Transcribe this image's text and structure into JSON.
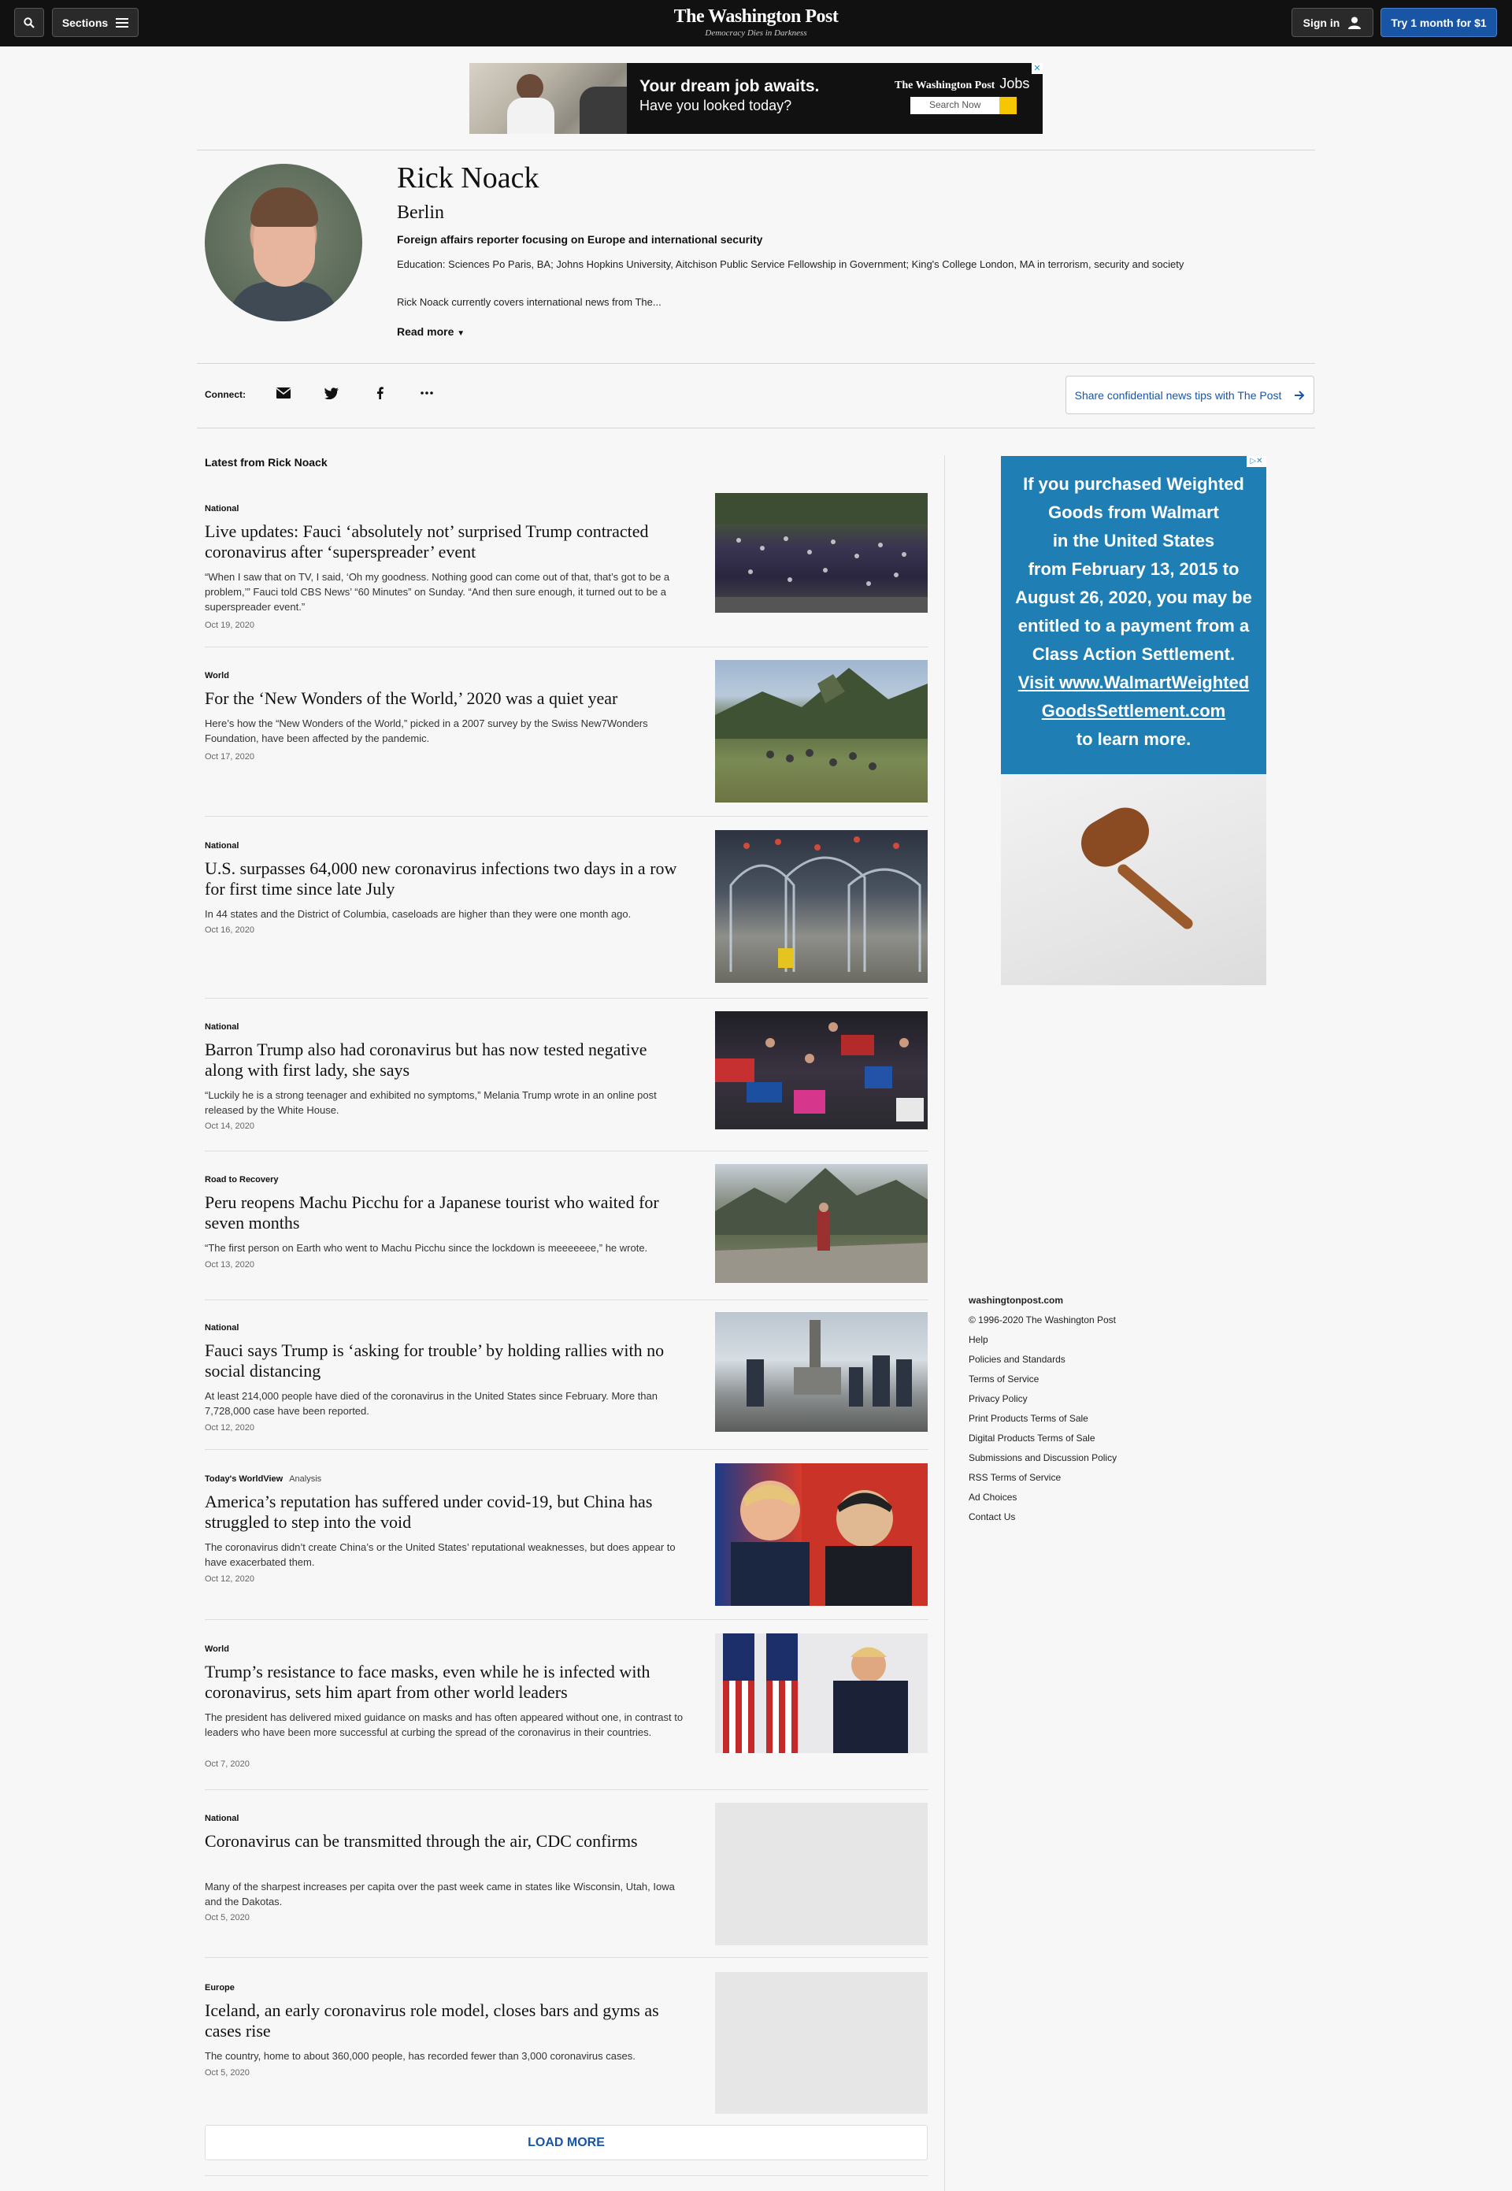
{
  "nav": {
    "sections_label": "Sections",
    "brand": "The Washington Post",
    "tagline": "Democracy Dies in Darkness",
    "signin_label": "Sign in",
    "subscribe_label": "Try 1 month for $1"
  },
  "top_ad": {
    "headline": "Your dream job awaits.",
    "subline": "Have you looked today?",
    "brand": "The Washington Post",
    "brand_suffix": "Jobs",
    "search_label": "Search Now"
  },
  "profile": {
    "name": "Rick Noack",
    "location": "Berlin",
    "title": "Foreign affairs reporter focusing on Europe and international security",
    "education": "Education: Sciences Po Paris, BA; Johns Hopkins University, Aitchison Public Service Fellowship in Government; King's College London, MA in terrorism, security and society",
    "bio": "Rick Noack currently covers international news from The...",
    "read_more": "Read more"
  },
  "connect": {
    "label": "Connect:",
    "icons": [
      "email-icon",
      "twitter-icon",
      "facebook-icon",
      "more-icon"
    ],
    "tips_label": "Share confidential news tips with The Post"
  },
  "latest_title": "Latest from Rick Noack",
  "articles": [
    {
      "kicker": "National",
      "headline": "Live updates: Fauci ‘absolutely not’ surprised Trump contracted coronavirus after ‘superspreader’ event",
      "blurb": "“When I saw that on TV, I said, ‘Oh my goodness. Nothing good can come out of that, that’s got to be a problem,’” Fauci told CBS News’ “60 Minutes” on Sunday. “And then sure enough, it turned out to be a superspreader event.”",
      "date": "Oct 19, 2020"
    },
    {
      "kicker": "World",
      "headline": "For the ‘New Wonders of the World,’ 2020 was a quiet year",
      "blurb": "Here’s how the “New Wonders of the World,” picked in a 2007 survey by the Swiss New7Wonders Foundation, have been affected by the pandemic.",
      "date": "Oct 17, 2020"
    },
    {
      "kicker": "National",
      "headline": "U.S. surpasses 64,000 new coronavirus infections two days in a row for first time since late July",
      "blurb": "In 44 states and the District of Columbia, caseloads are higher than they were one month ago.",
      "date": "Oct 16, 2020"
    },
    {
      "kicker": "National",
      "headline": "Barron Trump also had coronavirus but has now tested negative along with first lady, she says",
      "blurb": "“Luckily he is a strong teenager and exhibited no symptoms,” Melania Trump wrote in an online post released by the White House.",
      "date": "Oct 14, 2020"
    },
    {
      "kicker": "Road to Recovery",
      "headline": "Peru reopens Machu Picchu for a Japanese tourist who waited for seven months",
      "blurb": "“The first person on Earth who went to Machu Picchu since the lockdown is meeeeeee,” he wrote.",
      "date": "Oct 13, 2020"
    },
    {
      "kicker": "National",
      "headline": "Fauci says Trump is ‘asking for trouble’ by holding rallies with no social distancing",
      "blurb": "At least 214,000 people have died of the coronavirus in the United States since February. More than 7,728,000 case have been reported.",
      "date": "Oct 12, 2020"
    },
    {
      "kicker": "Today's WorldView",
      "kicker_extra": "Analysis",
      "headline": "America’s reputation has suffered under covid-19, but China has struggled to step into the void",
      "blurb": "The coronavirus didn’t create China’s or the United States’ reputational weaknesses, but does appear to have exacerbated them.",
      "date": "Oct 12, 2020"
    },
    {
      "kicker": "World",
      "headline": "Trump’s resistance to face masks, even while he is infected with coronavirus, sets him apart from other world leaders",
      "blurb": "The president has delivered mixed guidance on masks and has often appeared without one, in contrast to leaders who have been more successful at curbing the spread of the coronavirus in their countries.",
      "date": "Oct 7, 2020"
    },
    {
      "kicker": "National",
      "headline": "Coronavirus can be transmitted through the air, CDC confirms",
      "blurb": "Many of the sharpest increases per capita over the past week came in states like Wisconsin, Utah, Iowa and the Dakotas.",
      "date": "Oct 5, 2020"
    },
    {
      "kicker": "Europe",
      "headline": "Iceland, an early coronavirus role model, closes bars and gyms as cases rise",
      "blurb": "The country, home to about 360,000 people, has recorded fewer than 3,000 coronavirus cases.",
      "date": "Oct 5, 2020"
    }
  ],
  "load_more": "LOAD MORE",
  "side_ad": {
    "line1": "If you purchased Weighted",
    "line2": "Goods from Walmart",
    "line3": "in the United States",
    "line4": "from February 13, 2015 to",
    "line5": "August 26, 2020, you may be",
    "line6": "entitled to a payment from a",
    "line7": "Class Action Settlement.",
    "line8": "Visit www.WalmartWeighted",
    "line9": "GoodsSettlement.com",
    "line10": "to learn more."
  },
  "footer": {
    "site": "washingtonpost.com",
    "copyright": "© 1996-2020 The Washington Post",
    "links": [
      "Help",
      "Policies and Standards",
      "Terms of Service",
      "Privacy Policy",
      "Print Products Terms of Sale",
      "Digital Products Terms of Sale",
      "Submissions and Discussion Policy",
      "RSS Terms of Service",
      "Ad Choices",
      "Contact Us"
    ]
  },
  "colors": {
    "accent": "#1955a5",
    "nav_bg": "#111111",
    "ad_blue": "#1f7fb4"
  }
}
